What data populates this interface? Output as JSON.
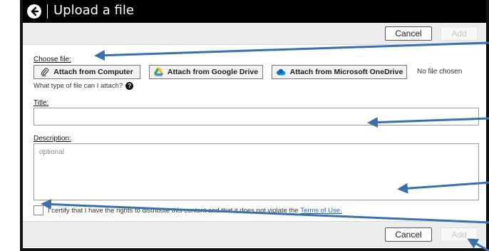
{
  "header": {
    "title": "Upload a file",
    "back_icon": "arrow-left-circle-icon"
  },
  "toolbar": {
    "cancel_label": "Cancel",
    "add_label": "Add"
  },
  "choose_file": {
    "label": "Choose file:",
    "buttons": [
      {
        "label": "Attach from Computer",
        "icon": "paperclip-icon"
      },
      {
        "label": "Attach from Google Drive",
        "icon": "google-drive-icon"
      },
      {
        "label": "Attach from Microsoft OneDrive",
        "icon": "onedrive-icon"
      }
    ],
    "status": "No file chosen",
    "help_text": "What type of file can I attach?"
  },
  "title_field": {
    "label": "Title:",
    "value": ""
  },
  "description_field": {
    "label": "Description:",
    "placeholder": "optional",
    "value": ""
  },
  "certify": {
    "text": "I certify that I have the rights to distribute this content and that it does not violate the",
    "link": "Terms of Use."
  },
  "colors": {
    "arrow": "#3a6fb0",
    "link": "#1a5fd0",
    "header_bg": "#000000"
  }
}
